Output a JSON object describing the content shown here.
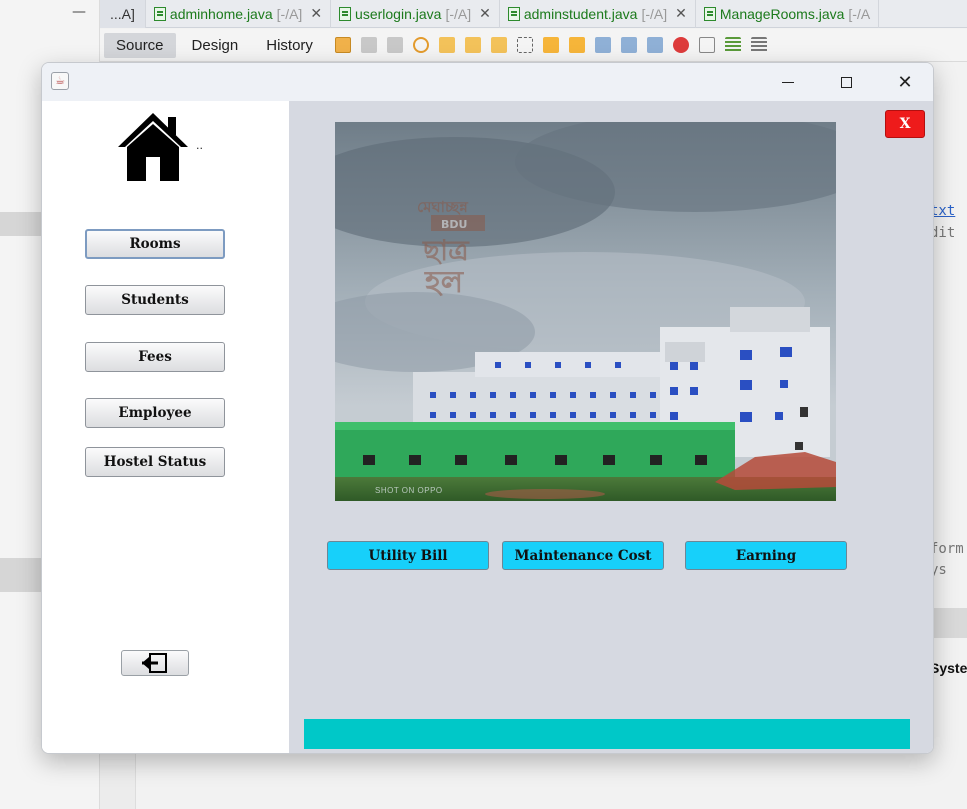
{
  "ide": {
    "tabs": [
      {
        "name": "...A]",
        "modifier": ""
      },
      {
        "name": "adminhome.java",
        "modifier": "[-/A]"
      },
      {
        "name": "userlogin.java",
        "modifier": "[-/A]"
      },
      {
        "name": "adminstudent.java",
        "modifier": "[-/A]"
      },
      {
        "name": "ManageRooms.java",
        "modifier": "[-/A"
      }
    ],
    "close_glyph": "✕",
    "views": [
      "Source",
      "Design",
      "History"
    ],
    "code_fragments": [
      "txt",
      "dit",
      "form",
      "ys"
    ],
    "panel_text": "Syste",
    "minimize_glyph": "—"
  },
  "window": {
    "controls": {
      "close": "✕"
    }
  },
  "sidebar": {
    "buttons": [
      "Rooms",
      "Students",
      "Fees",
      "Employee",
      "Hostel Status"
    ],
    "home_dots": ".."
  },
  "content": {
    "close_label": "X",
    "photo_credit": "SHOT ON OPPO",
    "watermark_lines": [
      "মেঘাচ্ছন্ন",
      "BDU",
      "ছাত্র",
      "হল"
    ],
    "actions": [
      "Utility Bill",
      "Maintenance Cost",
      "Earning"
    ]
  },
  "colors": {
    "sidebar_bg": "#ffffff",
    "content_bg": "#d6d9e1",
    "action_button": "#17d0fa",
    "close_button": "#ee1b1b",
    "status_bar": "#00c8c8"
  }
}
